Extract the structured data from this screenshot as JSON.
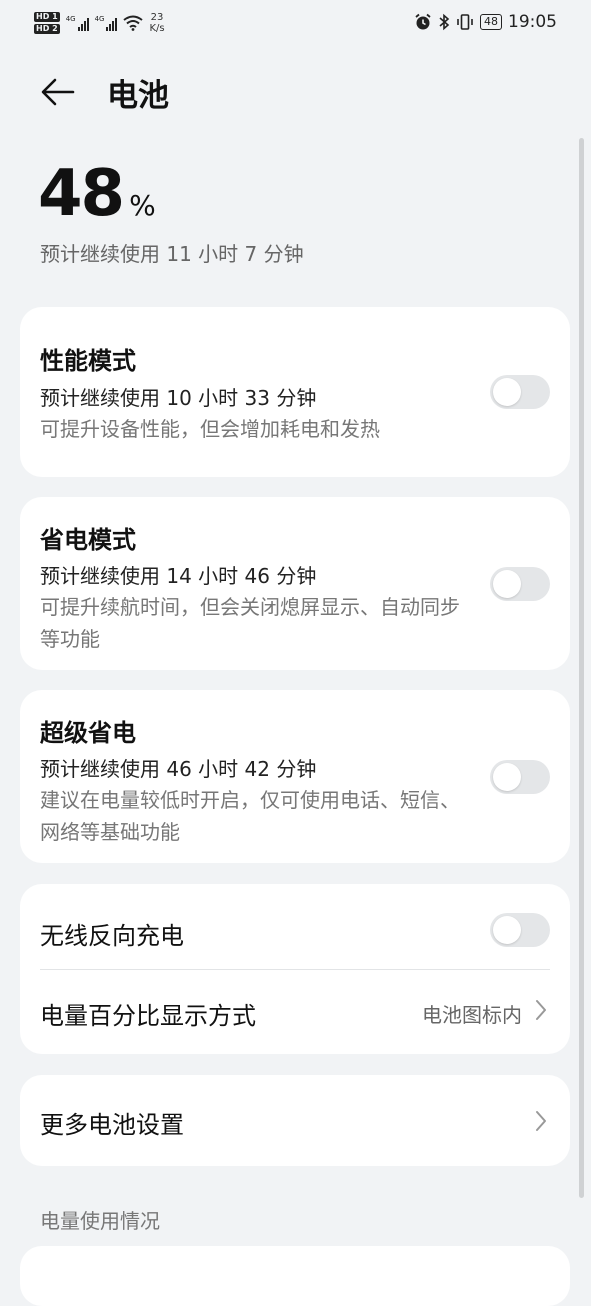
{
  "status_bar": {
    "hd1": "HD 1",
    "hd2": "HD 2",
    "net1": "4G",
    "net2": "4G",
    "speed_value": "23",
    "speed_unit": "K/s",
    "battery": "48",
    "time": "19:05"
  },
  "header": {
    "title": "电池"
  },
  "summary": {
    "percent": "48",
    "percent_sign": "%",
    "estimate": "预计继续使用 11 小时 7 分钟"
  },
  "modes": [
    {
      "title": "性能模式",
      "estimate": "预计继续使用 10 小时 33 分钟",
      "desc": "可提升设备性能，但会增加耗电和发热",
      "enabled": false
    },
    {
      "title": "省电模式",
      "estimate": "预计继续使用 14 小时 46 分钟",
      "desc": "可提升续航时间，但会关闭熄屏显示、自动同步等功能",
      "enabled": false
    },
    {
      "title": "超级省电",
      "estimate": "预计继续使用 46 小时 42 分钟",
      "desc": "建议在电量较低时开启，仅可使用电话、短信、网络等基础功能",
      "enabled": false
    }
  ],
  "reverse_charge": {
    "label": "无线反向充电",
    "enabled": false
  },
  "percent_display": {
    "label": "电量百分比显示方式",
    "value": "电池图标内"
  },
  "more": {
    "label": "更多电池设置"
  },
  "section": {
    "title": "电量使用情况"
  },
  "icons": {
    "back": "back-arrow-icon",
    "chevron": "chevron-right-icon",
    "alarm": "alarm-icon",
    "bluetooth": "bluetooth-icon",
    "vibrate": "vibrate-icon",
    "wifi": "wifi-icon",
    "signal": "signal-icon"
  }
}
